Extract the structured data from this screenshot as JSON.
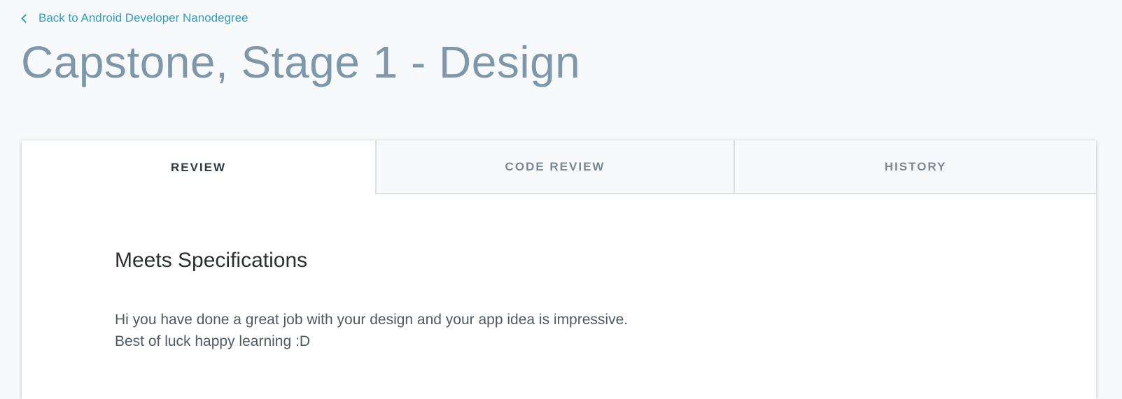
{
  "nav": {
    "back_label": "Back to Android Developer Nanodegree"
  },
  "page": {
    "title": "Capstone, Stage 1 - Design"
  },
  "tabs": [
    {
      "label": "REVIEW",
      "active": true
    },
    {
      "label": "CODE REVIEW",
      "active": false
    },
    {
      "label": "HISTORY",
      "active": false
    }
  ],
  "review": {
    "result": "Meets Specifications",
    "comment_lines": [
      "Hi you have done a great job with your design and your app idea is impressive.",
      "Best of luck happy learning :D"
    ]
  },
  "colors": {
    "link": "#2e9fc7",
    "title": "#7d97ab",
    "background": "#f8f9fb",
    "card": "#ffffff"
  }
}
